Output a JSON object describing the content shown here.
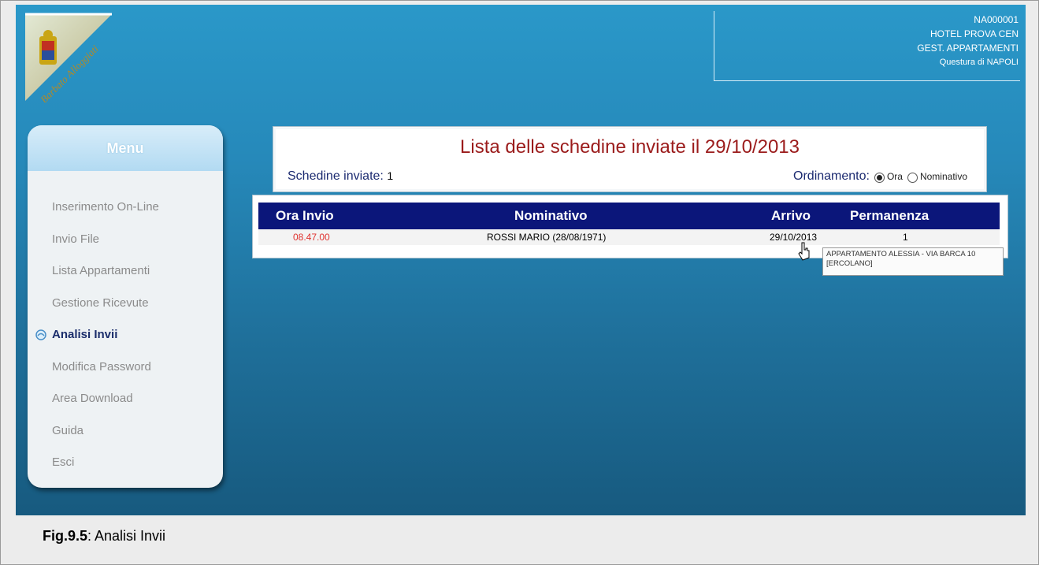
{
  "header": {
    "code": "NA000001",
    "hotel": "HOTEL PROVA CEN",
    "role": "GEST. APPARTAMENTI",
    "office": "Questura di NAPOLI"
  },
  "logo_text": "Barbato Alloggiati",
  "menu": {
    "title": "Menu",
    "items": [
      {
        "label": "Inserimento On-Line"
      },
      {
        "label": "Invio File"
      },
      {
        "label": "Lista Appartamenti"
      },
      {
        "label": "Gestione Ricevute"
      },
      {
        "label": "Analisi Invii"
      },
      {
        "label": "Modifica Password"
      },
      {
        "label": "Area Download"
      },
      {
        "label": "Guida"
      },
      {
        "label": "Esci"
      }
    ]
  },
  "main": {
    "title": "Lista delle schedine inviate il 29/10/2013",
    "sent_label": "Schedine inviate:",
    "sent_count": "1",
    "order_label": "Ordinamento:",
    "order_options": [
      "Ora",
      "Nominativo"
    ],
    "order_selected": "Ora"
  },
  "table": {
    "headers": [
      "Ora Invio",
      "Nominativo",
      "Arrivo",
      "Permanenza"
    ],
    "rows": [
      {
        "ora": "08.47.00",
        "nominativo": "ROSSI MARIO (28/08/1971)",
        "arrivo": "29/10/2013",
        "permanenza": "1"
      }
    ]
  },
  "tooltip": {
    "line1": "APPARTAMENTO ALESSIA - VIA BARCA 10",
    "line2": "[ERCOLANO]"
  },
  "caption": {
    "label": "Fig.9.5",
    "text": ": Analisi Invii"
  },
  "colors": {
    "title": "#9b1b1b",
    "table_header": "#0b167a",
    "time": "#e0322f",
    "active_menu": "#1a2d6b"
  }
}
